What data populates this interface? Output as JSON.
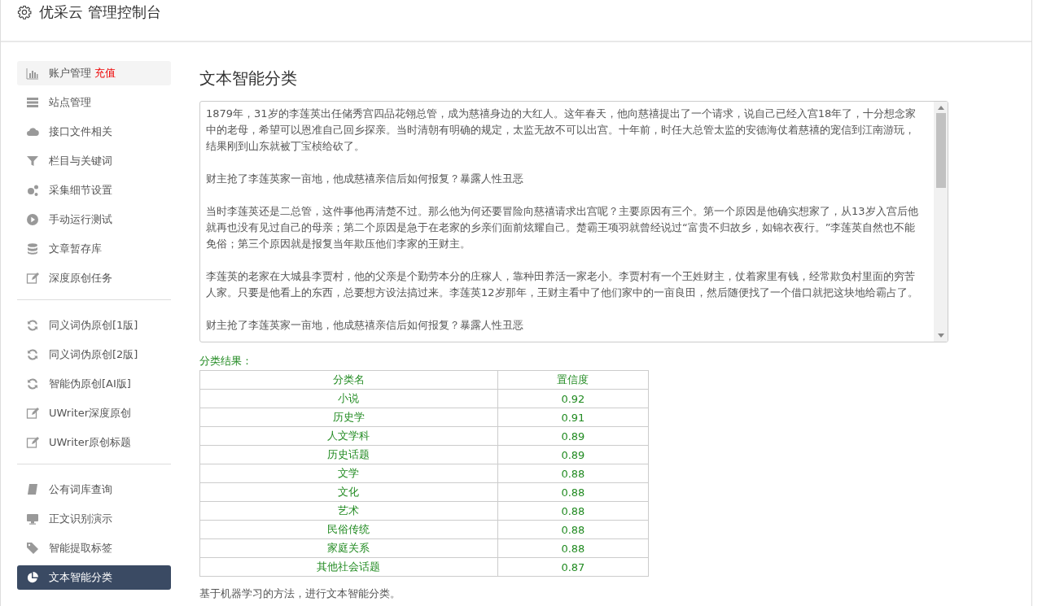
{
  "header": {
    "title": "优采云 管理控制台"
  },
  "sidebar": {
    "groups": [
      {
        "items": [
          {
            "label": "账户管理",
            "badge": "充值",
            "selected": false
          },
          {
            "label": "站点管理",
            "selected": false
          },
          {
            "label": "接口文件相关",
            "selected": false
          },
          {
            "label": "栏目与关键词",
            "selected": false
          },
          {
            "label": "采集细节设置",
            "selected": false
          },
          {
            "label": "手动运行测试",
            "selected": false
          },
          {
            "label": "文章暂存库",
            "selected": false
          },
          {
            "label": "深度原创任务",
            "selected": false
          }
        ]
      },
      {
        "items": [
          {
            "label": "同义词伪原创[1版]",
            "selected": false
          },
          {
            "label": "同义词伪原创[2版]",
            "selected": false
          },
          {
            "label": "智能伪原创[AI版]",
            "selected": false
          },
          {
            "label": "UWriter深度原创",
            "selected": false
          },
          {
            "label": "UWriter原创标题",
            "selected": false
          }
        ]
      },
      {
        "items": [
          {
            "label": "公有词库查询",
            "selected": false
          },
          {
            "label": "正文识别演示",
            "selected": false
          },
          {
            "label": "智能提取标签",
            "selected": false
          },
          {
            "label": "文本智能分类",
            "selected": true
          }
        ]
      }
    ]
  },
  "main": {
    "title": "文本智能分类",
    "input_text": {
      "paragraphs": [
        "1879年，31岁的李莲英出任储秀宫四品花翎总管，成为慈禧身边的大红人。这年春天，他向慈禧提出了一个请求，说自己已经入宫18年了，十分想念家中的老母，希望可以恩准自己回乡探亲。当时清朝有明确的规定，太监无故不可以出宫。十年前，时任大总管太监的安德海仗着慈禧的宠信到江南游玩，结果刚到山东就被丁宝桢给砍了。",
        "财主抢了李莲英家一亩地，他成慈禧亲信后如何报复？暴露人性丑恶",
        "当时李莲英还是二总管，这件事他再清楚不过。那么他为何还要冒险向慈禧请求出宫呢？主要原因有三个。第一个原因是他确实想家了，从13岁入宫后他就再也没有见过自己的母亲；第二个原因是急于在老家的乡亲们面前炫耀自己。楚霸王项羽就曾经说过“富贵不归故乡，如锦衣夜行。”李莲英自然也不能免俗；第三个原因就是报复当年欺压他们李家的王财主。",
        "李莲英的老家在大城县李贾村，他的父亲是个勤劳本分的庄稼人，靠种田养活一家老小。李贾村有一个王姓财主，仗着家里有钱，经常欺负村里面的穷苦人家。只要是他看上的东西，总要想方设法搞过来。李莲英12岁那年，王财主看中了他们家中的一亩良田，然后随便找了一个借口就把这块地给霸占了。",
        "财主抢了李莲英家一亩地，他成慈禧亲信后如何报复？暴露人性丑恶"
      ]
    },
    "result_title": "分类结果：",
    "table": {
      "columns": [
        "分类名",
        "置信度"
      ],
      "rows": [
        [
          "小说",
          "0.92"
        ],
        [
          "历史学",
          "0.91"
        ],
        [
          "人文学科",
          "0.89"
        ],
        [
          "历史话题",
          "0.89"
        ],
        [
          "文学",
          "0.88"
        ],
        [
          "文化",
          "0.88"
        ],
        [
          "艺术",
          "0.88"
        ],
        [
          "民俗传统",
          "0.88"
        ],
        [
          "家庭关系",
          "0.88"
        ],
        [
          "其他社会话题",
          "0.87"
        ]
      ]
    },
    "note": "基于机器学习的方法，进行文本智能分类。"
  }
}
